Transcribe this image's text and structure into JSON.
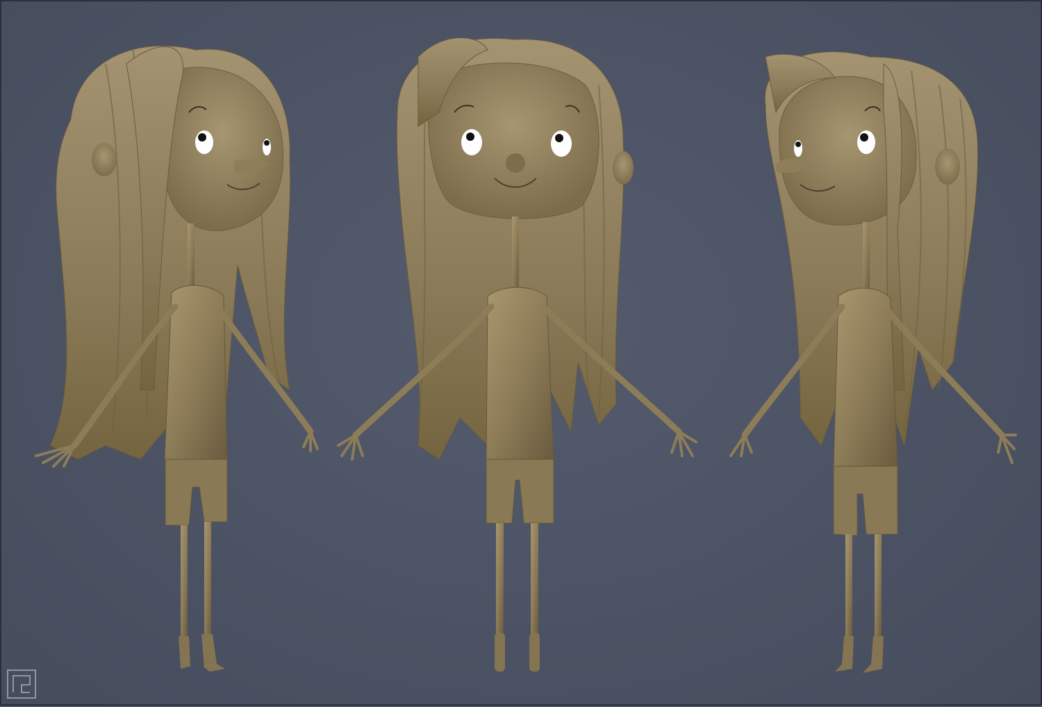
{
  "scene": {
    "background_color": "#4c5465",
    "clay_color": "#8b7a58",
    "views": [
      {
        "name": "three-quarter-left"
      },
      {
        "name": "front"
      },
      {
        "name": "three-quarter-right"
      }
    ],
    "logo_icon": "studio-logo-icon"
  }
}
